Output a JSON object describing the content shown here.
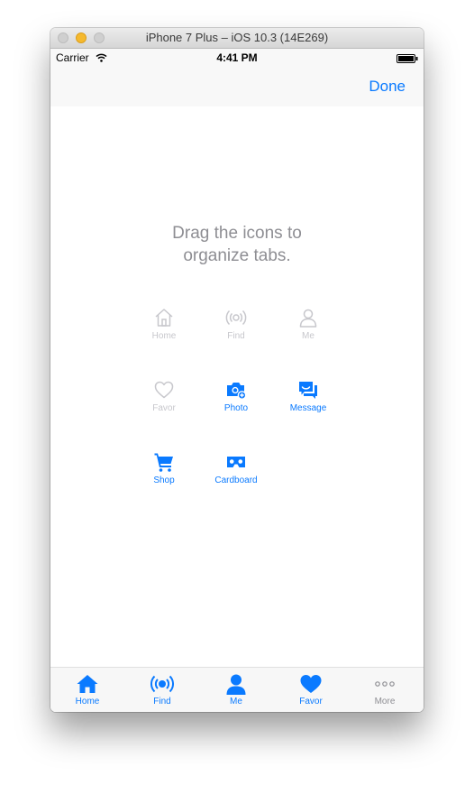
{
  "window": {
    "title": "iPhone 7 Plus – iOS 10.3 (14E269)"
  },
  "status_bar": {
    "carrier": "Carrier",
    "time": "4:41 PM",
    "icons": [
      "wifi-icon",
      "battery-icon"
    ]
  },
  "nav_bar": {
    "done_label": "Done"
  },
  "instruction": {
    "line1": "Drag the icons to",
    "line2": "organize tabs."
  },
  "tab_items": [
    {
      "label": "Home",
      "icon": "home-icon",
      "state": "in-tab-bar"
    },
    {
      "label": "Find",
      "icon": "broadcast-icon",
      "state": "in-tab-bar"
    },
    {
      "label": "Me",
      "icon": "person-icon",
      "state": "in-tab-bar"
    },
    {
      "label": "Favor",
      "icon": "heart-icon",
      "state": "in-tab-bar"
    },
    {
      "label": "Photo",
      "icon": "camera-icon",
      "state": "available"
    },
    {
      "label": "Message",
      "icon": "message-icon",
      "state": "available"
    },
    {
      "label": "Shop",
      "icon": "cart-icon",
      "state": "available"
    },
    {
      "label": "Cardboard",
      "icon": "cardboard-icon",
      "state": "available"
    }
  ],
  "tab_bar": [
    {
      "label": "Home",
      "icon": "home-icon"
    },
    {
      "label": "Find",
      "icon": "broadcast-icon"
    },
    {
      "label": "Me",
      "icon": "person-icon"
    },
    {
      "label": "Favor",
      "icon": "heart-icon"
    },
    {
      "label": "More",
      "icon": "more-icon"
    }
  ],
  "colors": {
    "accent": "#0a7aff",
    "dimmed": "#c7c7cc",
    "instruction_text": "#8e8e93"
  }
}
